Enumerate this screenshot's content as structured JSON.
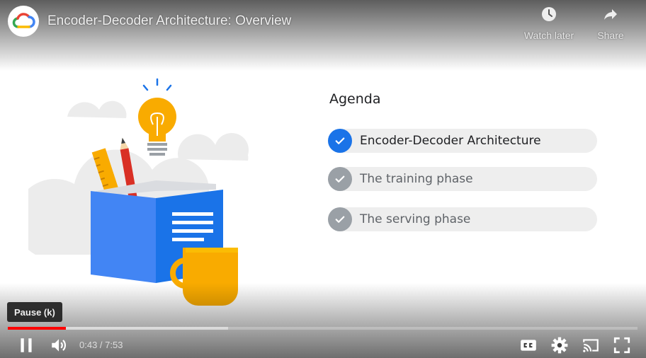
{
  "video": {
    "title": "Encoder-Decoder Architecture: Overview",
    "channel_logo_icon": "google-cloud-logo"
  },
  "top_actions": [
    {
      "label": "Watch later",
      "icon": "clock-icon"
    },
    {
      "label": "Share",
      "icon": "share-arrow-icon"
    }
  ],
  "slide": {
    "agenda_title": "Agenda",
    "items": [
      {
        "label": "Encoder-Decoder Architecture",
        "state": "active"
      },
      {
        "label": "The training phase",
        "state": "inactive"
      },
      {
        "label": "The serving phase",
        "state": "inactive"
      }
    ]
  },
  "player": {
    "tooltip": "Pause (k)",
    "current_time": "0:43",
    "separator": " / ",
    "duration": "7:53",
    "progress_played": 0.092,
    "progress_loaded": 0.35,
    "icons": [
      "pause-icon",
      "volume-icon",
      "captions-icon",
      "settings-gear-icon",
      "cast-icon",
      "fullscreen-icon"
    ]
  },
  "colors": {
    "accent_blue": "#1a73e8",
    "progress_red": "#ff0000",
    "inactive_grey": "#9aa0a6"
  }
}
